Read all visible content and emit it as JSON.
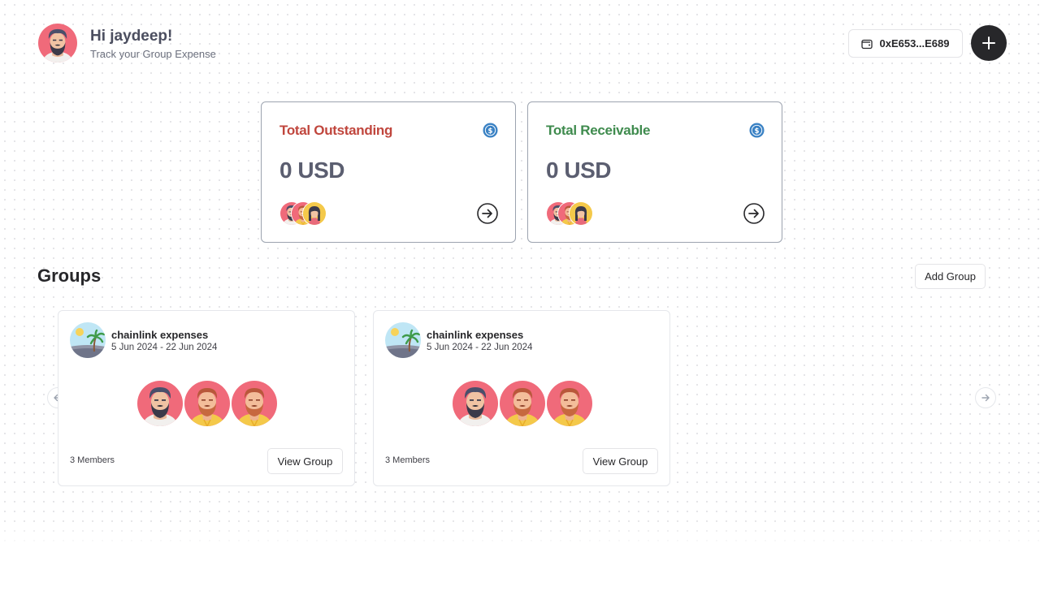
{
  "header": {
    "greeting": "Hi jaydeep!",
    "subtitle": "Track your Group Expense",
    "avatar_icon": "bearded-man-avatar",
    "wallet_address": "0xE653...E689",
    "wallet_icon": "wallet-icon",
    "add_icon": "plus-icon"
  },
  "summary": {
    "outstanding": {
      "title": "Total Outstanding",
      "amount": "0 USD",
      "title_color": "#c0463d",
      "icon": "usdc-coin-icon",
      "arrow_icon": "arrow-right-circle-icon"
    },
    "receivable": {
      "title": "Total Receivable",
      "amount": "0 USD",
      "title_color": "#3f8b4e",
      "icon": "usdc-coin-icon",
      "arrow_icon": "arrow-right-circle-icon"
    }
  },
  "groups": {
    "title": "Groups",
    "add_label": "Add Group",
    "items": [
      {
        "name": "chainlink expenses",
        "dates": "5 Jun 2024 - 22 Jun 2024",
        "members_label": "3 Members",
        "view_label": "View Group",
        "thumb_icon": "beach-palm-icon"
      },
      {
        "name": "chainlink expenses",
        "dates": "5 Jun 2024 - 22 Jun 2024",
        "members_label": "3 Members",
        "view_label": "View Group",
        "thumb_icon": "beach-palm-icon"
      }
    ],
    "prev_icon": "arrow-left-icon",
    "next_icon": "arrow-right-icon"
  },
  "colors": {
    "accent_dark": "#27272a",
    "outstanding": "#c0463d",
    "receivable": "#3f8b4e",
    "coin": "#3b82c4"
  }
}
